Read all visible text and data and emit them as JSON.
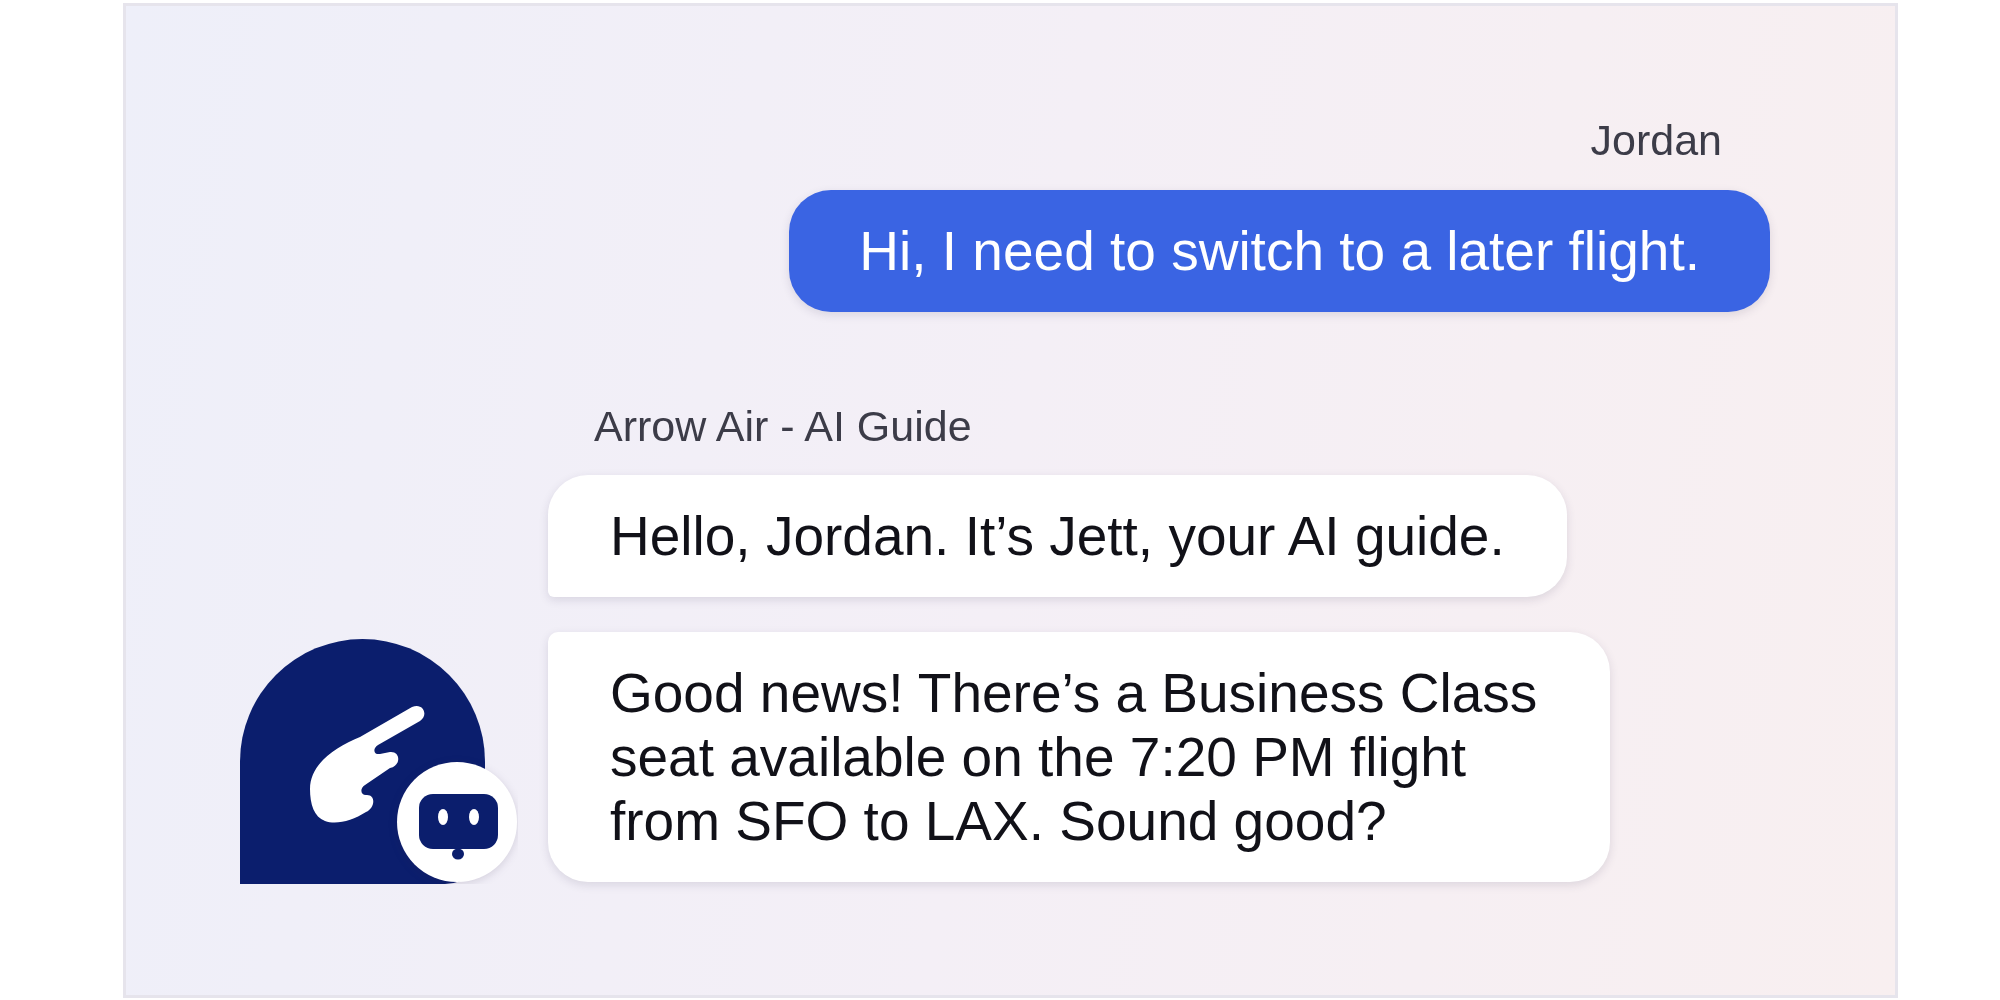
{
  "messages": [
    {
      "kind": "user",
      "sender": "Jordan",
      "bubbles": [
        "Hi, I need to switch to a later flight."
      ]
    },
    {
      "kind": "bot",
      "sender": "Arrow Air - AI Guide",
      "bubbles": [
        "Hello, Jordan. It’s Jett, your AI guide.",
        "Good news! There’s a Business Class seat available on the 7:20 PM flight from SFO to LAX. Sound good?"
      ]
    }
  ]
}
